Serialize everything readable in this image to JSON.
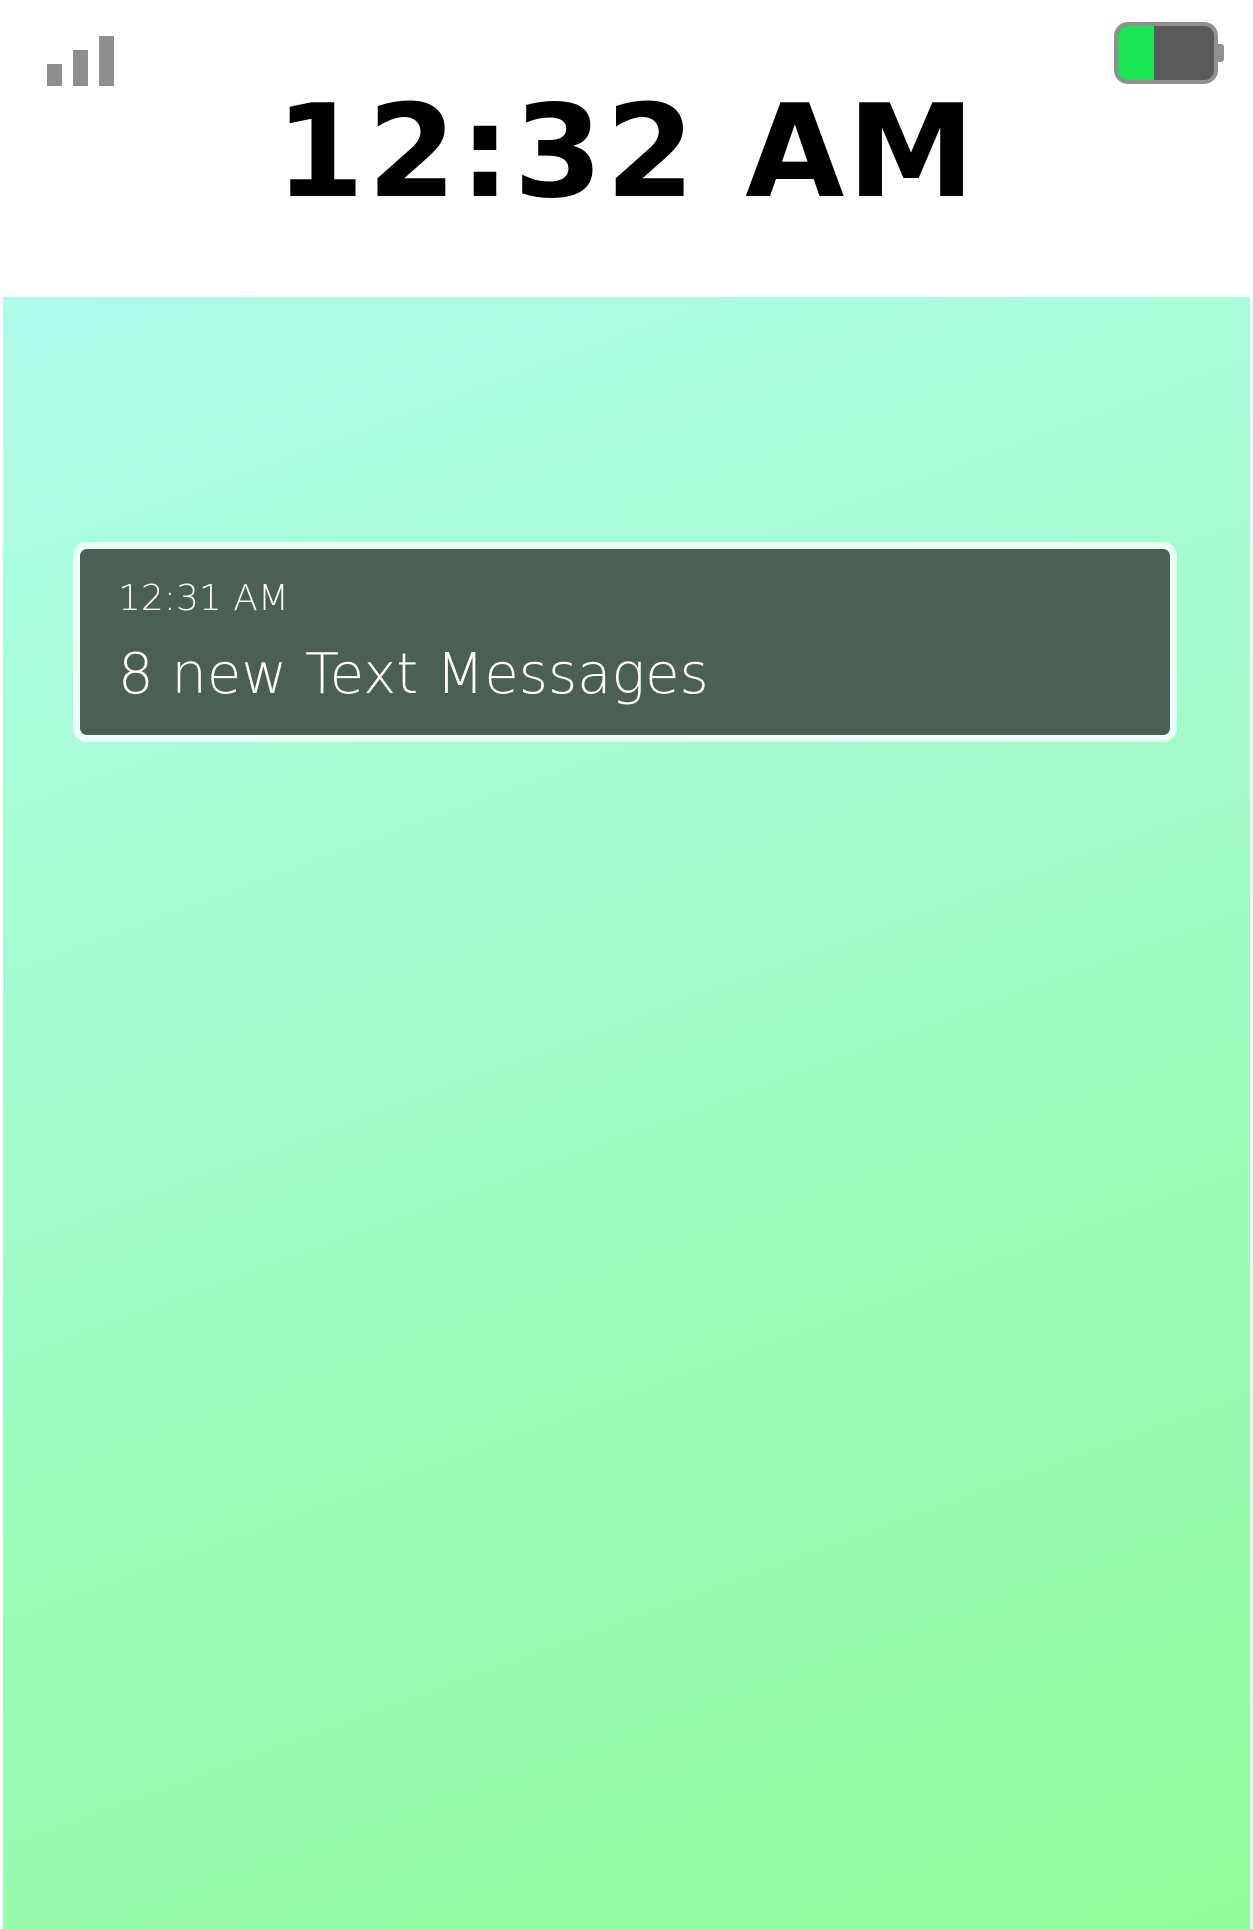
{
  "status_bar": {
    "time": "12:32 AM",
    "signal_icon": "signal-bars-icon",
    "battery_icon": "battery-icon",
    "battery_level": 0.38
  },
  "notification": {
    "time": "12:31 AM",
    "title": "8 new Text Messages"
  },
  "colors": {
    "wallpaper_top": "#aefcea",
    "wallpaper_bottom": "#94fb9c",
    "notification_bg": "#4b6055",
    "battery_fill": "#1ae654"
  }
}
